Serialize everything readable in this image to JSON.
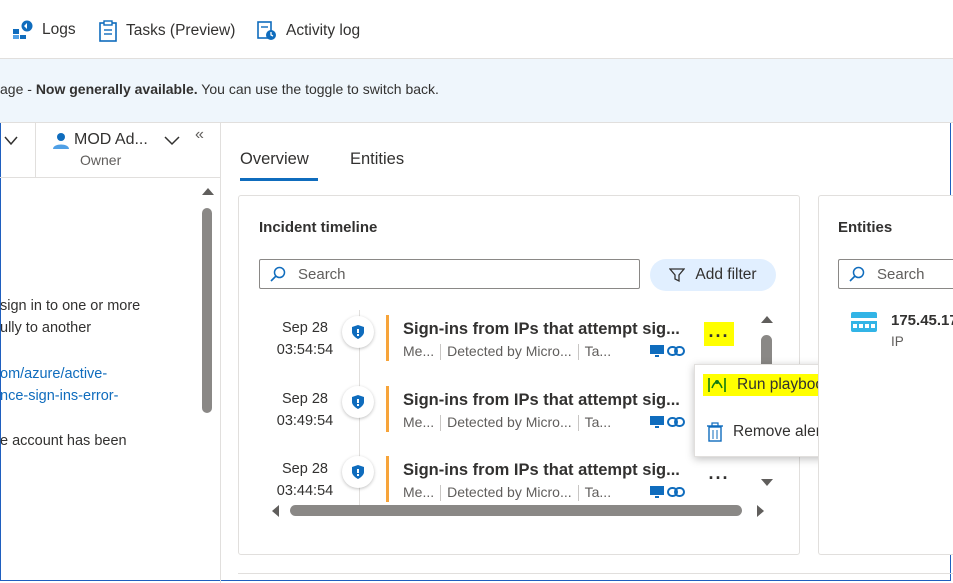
{
  "toolbar": {
    "logs_label": "Logs",
    "tasks_label": "Tasks (Preview)",
    "activity_label": "Activity log"
  },
  "banner": {
    "prefix": "age - ",
    "bold": "Now generally available.",
    "rest": " You can use the toggle to switch back."
  },
  "owner": {
    "name": "MOD Ad...",
    "role": "Owner"
  },
  "left_panel": {
    "lines": [
      "sign in to one or more",
      "ully to another",
      "om/azure/active-",
      "nce-sign-ins-error-",
      "e account has been"
    ]
  },
  "tabs": [
    {
      "label": "Overview",
      "active": true
    },
    {
      "label": "Entities",
      "active": false
    }
  ],
  "timeline": {
    "title": "Incident timeline",
    "search_placeholder": "Search",
    "filter_label": "Add filter",
    "events": [
      {
        "date": "Sep 28",
        "time": "03:54:54",
        "title": "Sign-ins from IPs that attempt sig...",
        "meta1": "Me...",
        "meta2": "Detected by Micro...",
        "meta3": "Ta...",
        "more_label": "...",
        "highlighted": true
      },
      {
        "date": "Sep 28",
        "time": "03:49:54",
        "title": "Sign-ins from IPs that attempt sig...",
        "meta1": "Me...",
        "meta2": "Detected by Micro...",
        "meta3": "Ta...",
        "more_label": "...",
        "highlighted": false
      },
      {
        "date": "Sep 28",
        "time": "03:44:54",
        "title": "Sign-ins from IPs that attempt sig...",
        "meta1": "Me...",
        "meta2": "Detected by Micro...",
        "meta3": "Ta...",
        "more_label": "...",
        "highlighted": false
      }
    ]
  },
  "context_menu": {
    "items": [
      {
        "label": "Run playbook",
        "icon": "playbook-icon",
        "highlighted": true
      },
      {
        "label": "Remove alert",
        "icon": "trash-icon",
        "highlighted": false
      }
    ]
  },
  "entities": {
    "title": "Entities",
    "search_placeholder": "Search",
    "items": [
      {
        "name": "175.45.17",
        "type": "IP",
        "icon": "ip-address-icon"
      }
    ]
  },
  "colors": {
    "accent": "#0f6cbd",
    "severity": "#f7a43a",
    "highlight": "#ffff00",
    "banner_bg": "#eff6fc"
  }
}
